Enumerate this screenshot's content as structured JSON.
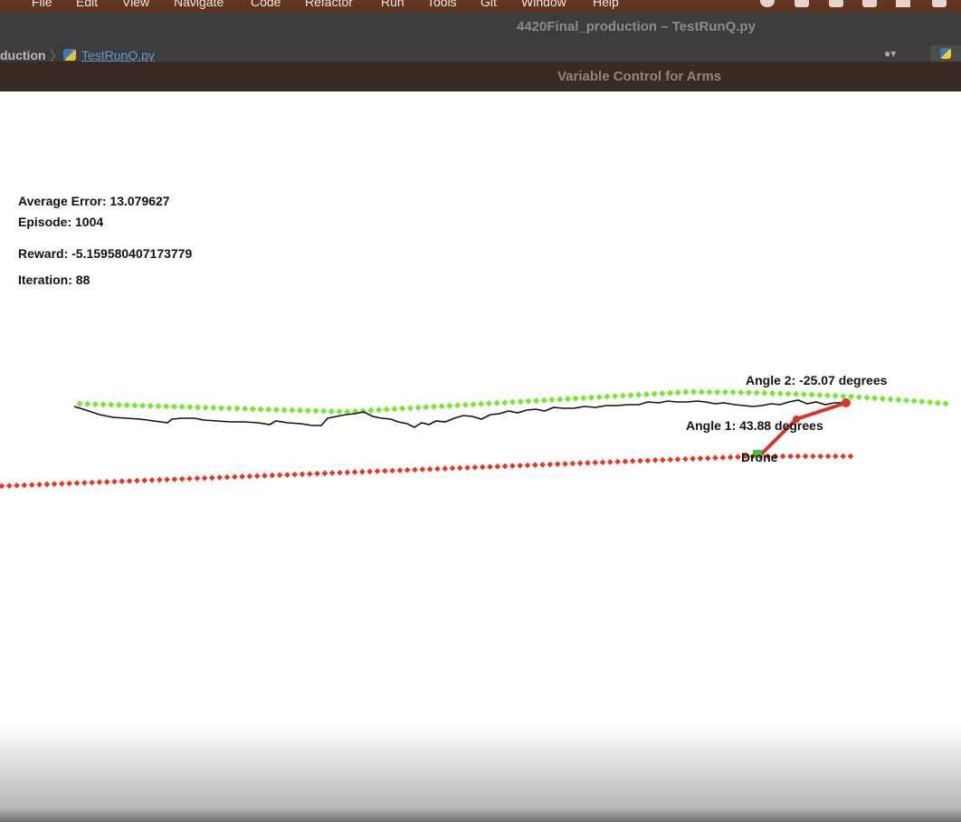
{
  "menubar": {
    "items": [
      "File",
      "Edit",
      "View",
      "Navigate",
      "Code",
      "Refactor",
      "Run",
      "Tools",
      "Git",
      "Window",
      "Help"
    ],
    "tray_icons": [
      "record-icon",
      "notion-icon",
      "image-icon",
      "drive-icon",
      "wifi-icon",
      "copy-icon"
    ]
  },
  "ide": {
    "title": "4420Final_production – TestRunQ.py",
    "breadcrumb_project": "duction",
    "breadcrumb_file": "TestRunQ.py"
  },
  "plot_window": {
    "title": "Variable Control for Arms"
  },
  "stats": {
    "average_error": "Average Error: 13.079627",
    "episode": "Episode: 1004",
    "reward": "Reward: -5.159580407173779",
    "iteration": "Iteration: 88"
  },
  "labels": {
    "angle1": "Angle 1: 43.88 degrees",
    "angle2": "Angle 2: -25.07 degrees",
    "drone": "Drone"
  },
  "colors": {
    "green_dots": "#7ae63a",
    "red_dots": "#e03a2a",
    "arm": "#d8342a",
    "trajectory": "#111111",
    "drone_base": "#3cc43c"
  }
}
